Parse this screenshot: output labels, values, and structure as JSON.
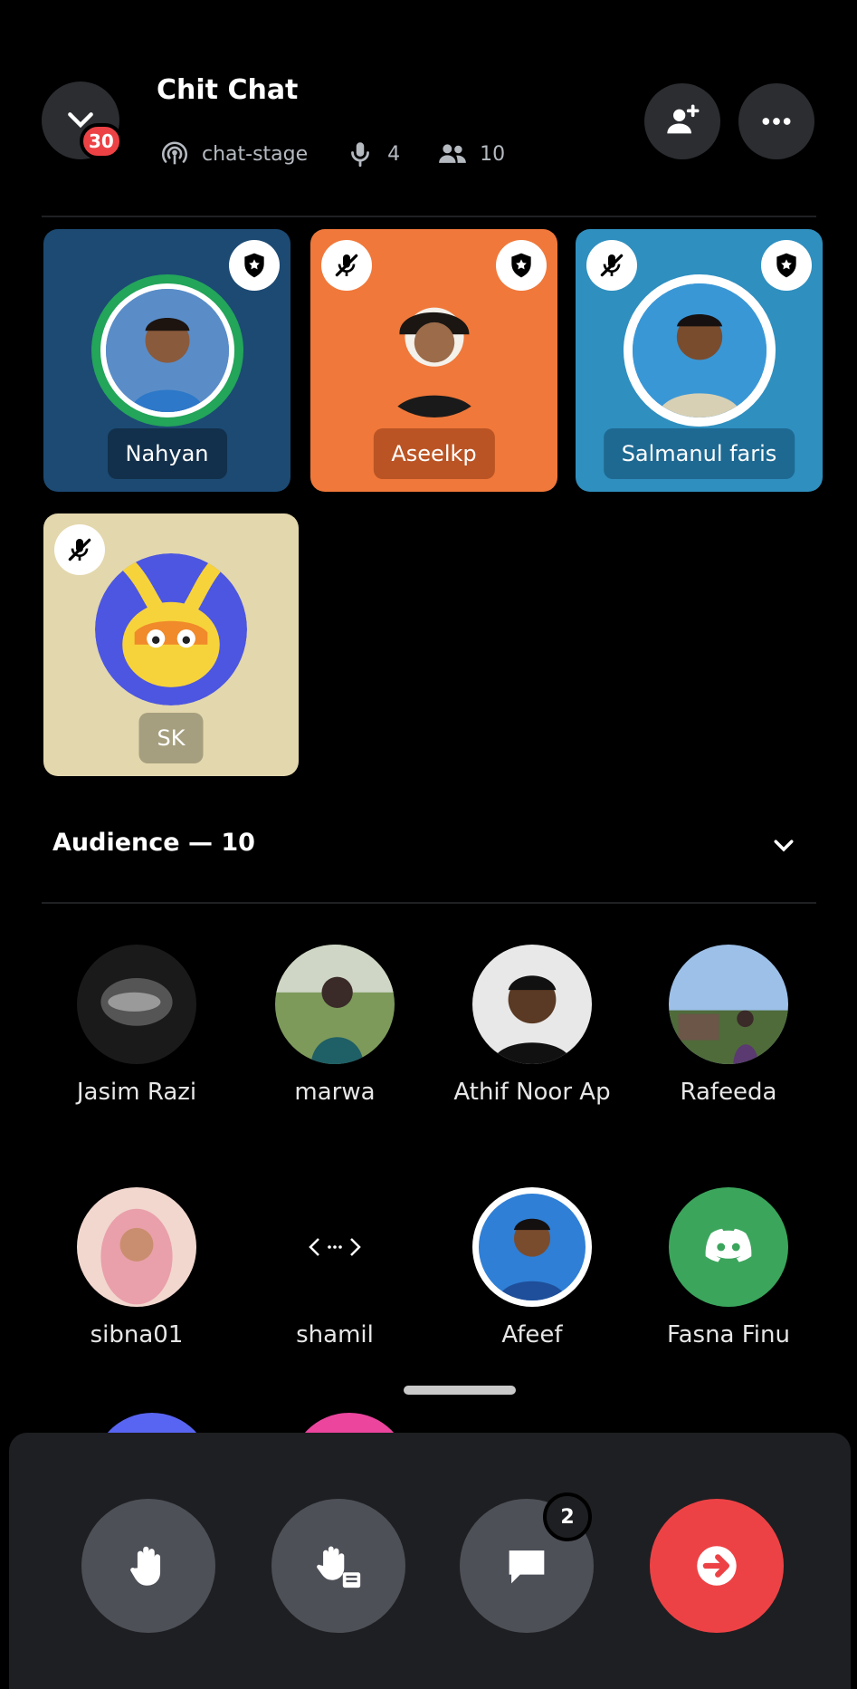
{
  "header": {
    "title": "Chit Chat",
    "notification_count": "30",
    "channel": "chat-stage",
    "speakers_count": "4",
    "listeners_count": "10"
  },
  "speakers": [
    {
      "name": "Nahyan",
      "bg": "#1c4a73",
      "muted": false,
      "moderator": true
    },
    {
      "name": "Aseelkp",
      "bg": "#f0783a",
      "muted": true,
      "moderator": true
    },
    {
      "name": "Salmanul faris",
      "bg": "#2f8fbf",
      "muted": true,
      "moderator": true
    },
    {
      "name": "SK",
      "bg": "#e3d7ad",
      "muted": true,
      "moderator": false
    }
  ],
  "audience": {
    "title": "Audience — 10",
    "members": [
      {
        "name": "Jasim Razi"
      },
      {
        "name": "marwa"
      },
      {
        "name": "Athif Noor Ap"
      },
      {
        "name": "Rafeeda"
      },
      {
        "name": "sibna01"
      },
      {
        "name": "shamil"
      },
      {
        "name": "Afeef"
      },
      {
        "name": "Fasna Finu"
      }
    ]
  },
  "controls": {
    "message_badge": "2"
  },
  "colors": {
    "speaking_ring": "#23a55a",
    "danger": "#ed4245",
    "discord_green": "#3ba55c"
  }
}
